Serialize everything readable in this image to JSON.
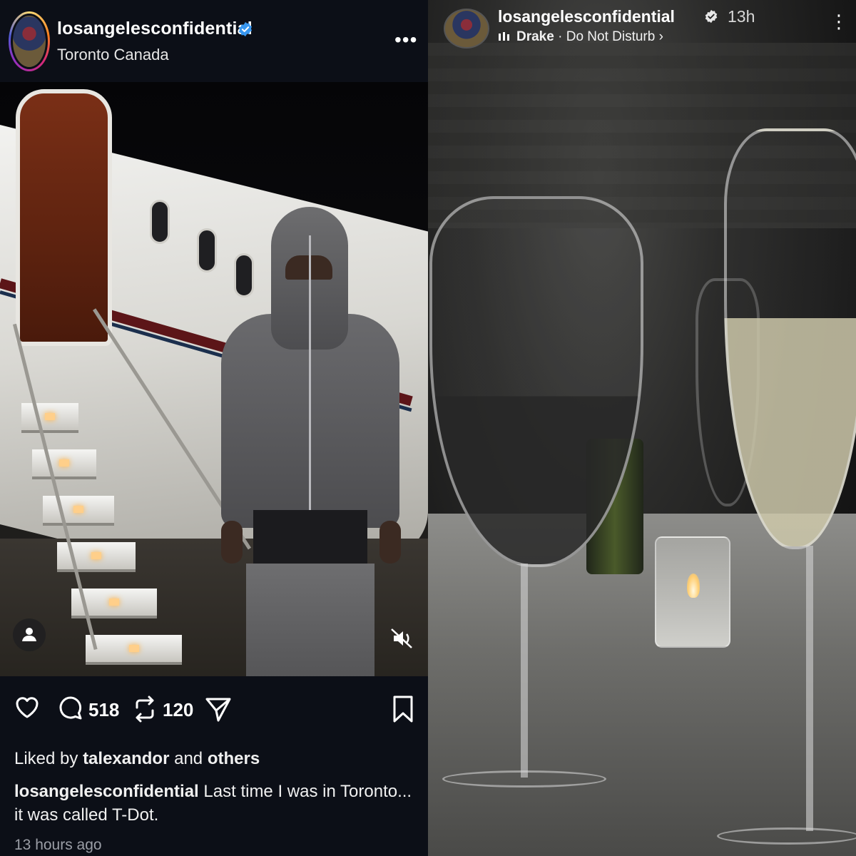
{
  "post": {
    "username": "losangelesconfidential",
    "location": "Toronto Canada",
    "more_label": "•••",
    "comments_count": "518",
    "reposts_count": "120",
    "liked_prefix": "Liked by",
    "liked_user": "talexandor",
    "liked_and": "and",
    "liked_others": "others",
    "caption_user": "losangelesconfidential",
    "caption_text": "Last time I was in Toronto... it was called T-Dot.",
    "time_ago": "13 hours ago"
  },
  "story": {
    "username": "losangelesconfidential",
    "time": "13h",
    "music_artist": "Drake",
    "music_separator": "·",
    "music_title": "Do Not Disturb",
    "music_chevron": "›",
    "more_label": "⋮"
  },
  "icons": {
    "verified": "verified-badge-icon",
    "heart": "heart-icon",
    "comment": "comment-icon",
    "repost": "repost-icon",
    "share": "share-icon",
    "bookmark": "bookmark-icon",
    "user_tag": "user-tag-icon",
    "mute": "muted-speaker-icon",
    "music": "music-bars-icon"
  },
  "colors": {
    "feed_background": "#0c0f17",
    "verified_blue": "#3897f0",
    "secondary_text": "#9b9ea6"
  }
}
